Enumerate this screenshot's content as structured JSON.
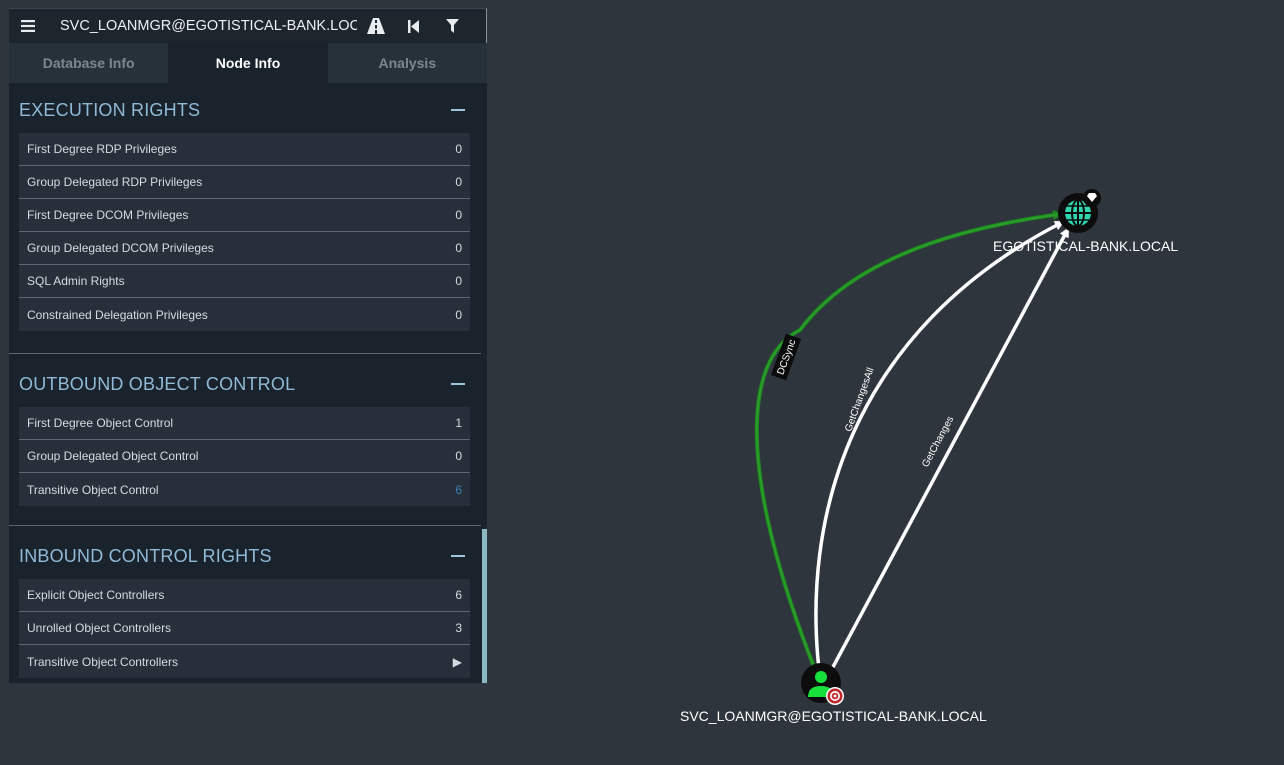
{
  "search": {
    "value": "SVC_LOANMGR@EGOTISTICAL-BANK.LOCAL"
  },
  "toolbar": {
    "menu_icon": "hamburger-menu-icon",
    "pathfinding_icon": "road-icon",
    "back_icon": "back-icon",
    "filter_icon": "filter-icon"
  },
  "tabs": [
    {
      "label": "Database Info",
      "active": false
    },
    {
      "label": "Node Info",
      "active": true
    },
    {
      "label": "Analysis",
      "active": false
    }
  ],
  "sections": [
    {
      "title": "EXECUTION RIGHTS",
      "rows": [
        {
          "label": "First Degree RDP Privileges",
          "value": "0"
        },
        {
          "label": "Group Delegated RDP Privileges",
          "value": "0"
        },
        {
          "label": "First Degree DCOM Privileges",
          "value": "0"
        },
        {
          "label": "Group Delegated DCOM Privileges",
          "value": "0"
        },
        {
          "label": "SQL Admin Rights",
          "value": "0"
        },
        {
          "label": "Constrained Delegation Privileges",
          "value": "0"
        }
      ]
    },
    {
      "title": "OUTBOUND OBJECT CONTROL",
      "rows": [
        {
          "label": "First Degree Object Control",
          "value": "1"
        },
        {
          "label": "Group Delegated Object Control",
          "value": "0"
        },
        {
          "label": "Transitive Object Control",
          "value": "6"
        }
      ]
    },
    {
      "title": "INBOUND CONTROL RIGHTS",
      "rows": [
        {
          "label": "Explicit Object Controllers",
          "value": "6"
        },
        {
          "label": "Unrolled Object Controllers",
          "value": "3"
        },
        {
          "label": "Transitive Object Controllers",
          "value": "▶"
        }
      ]
    }
  ],
  "graph": {
    "nodes": {
      "domain": {
        "label": "EGOTISTICAL-BANK.LOCAL",
        "icon": "globe-icon",
        "badge": "diamond-icon"
      },
      "user": {
        "label": "SVC_LOANMGR@EGOTISTICAL-BANK.LOCAL",
        "icon": "user-icon",
        "badge": "target-icon"
      }
    },
    "edges": [
      {
        "label": "DCSync",
        "color": "#1e8c1e"
      },
      {
        "label": "GetChangesAll",
        "color": "#ffffff"
      },
      {
        "label": "GetChanges",
        "color": "#ffffff"
      }
    ]
  },
  "colors": {
    "background": "#2f353d",
    "panel": "#1a222b",
    "section_title": "#8fbad8",
    "link_value": "#3d7fb3",
    "dcsync_edge": "#1e8c1e",
    "domain_node": "#2fd6b0",
    "user_node": "#17e03c"
  }
}
